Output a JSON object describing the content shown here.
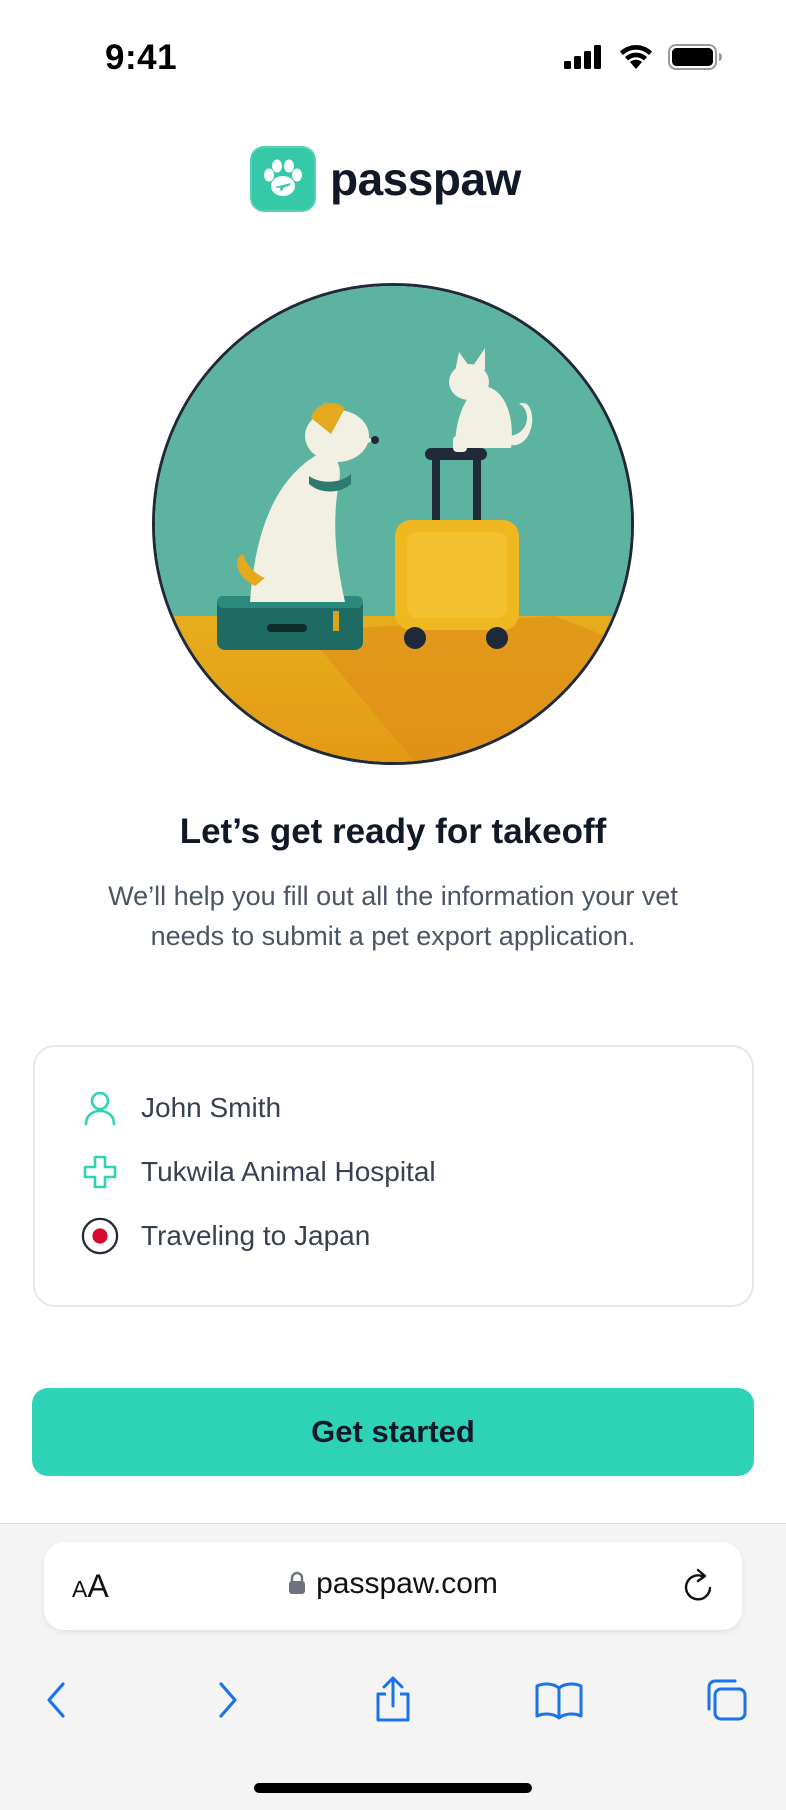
{
  "status": {
    "time": "9:41"
  },
  "brand": {
    "name": "passpaw",
    "accent": "#2ed3b7"
  },
  "hero": {
    "illustration": "dog-and-cat-with-suitcases"
  },
  "headline": "Let’s get ready for takeoff",
  "subtext": "We’ll help you fill out all the information your vet needs to submit a pet export application.",
  "info": [
    {
      "icon": "user-icon",
      "label": "John Smith"
    },
    {
      "icon": "medical-cross-icon",
      "label": "Tukwila Animal Hospital"
    },
    {
      "icon": "japan-flag-icon",
      "label": "Traveling to Japan"
    }
  ],
  "cta": {
    "label": "Get started"
  },
  "browser": {
    "text_size_small": "A",
    "text_size_large": "A",
    "url": "passpaw.com"
  }
}
